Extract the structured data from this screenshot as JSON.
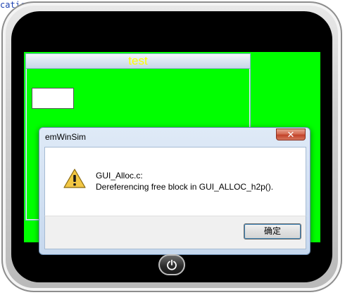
{
  "corner_text": "catic",
  "framewin": {
    "title": "test"
  },
  "dialog": {
    "title": "emWinSim",
    "close_label": "✕",
    "message_line1": "GUI_Alloc.c:",
    "message_line2": "Dereferencing free block in GUI_ALLOC_h2p().",
    "ok_label": "确定"
  },
  "icons": {
    "dialog": "warning-icon",
    "close": "close-icon",
    "home": "power-icon"
  },
  "colors": {
    "screen_bg": "#00ff00",
    "framewin_title_text": "#ffff00",
    "close_button": "#c2432a"
  }
}
